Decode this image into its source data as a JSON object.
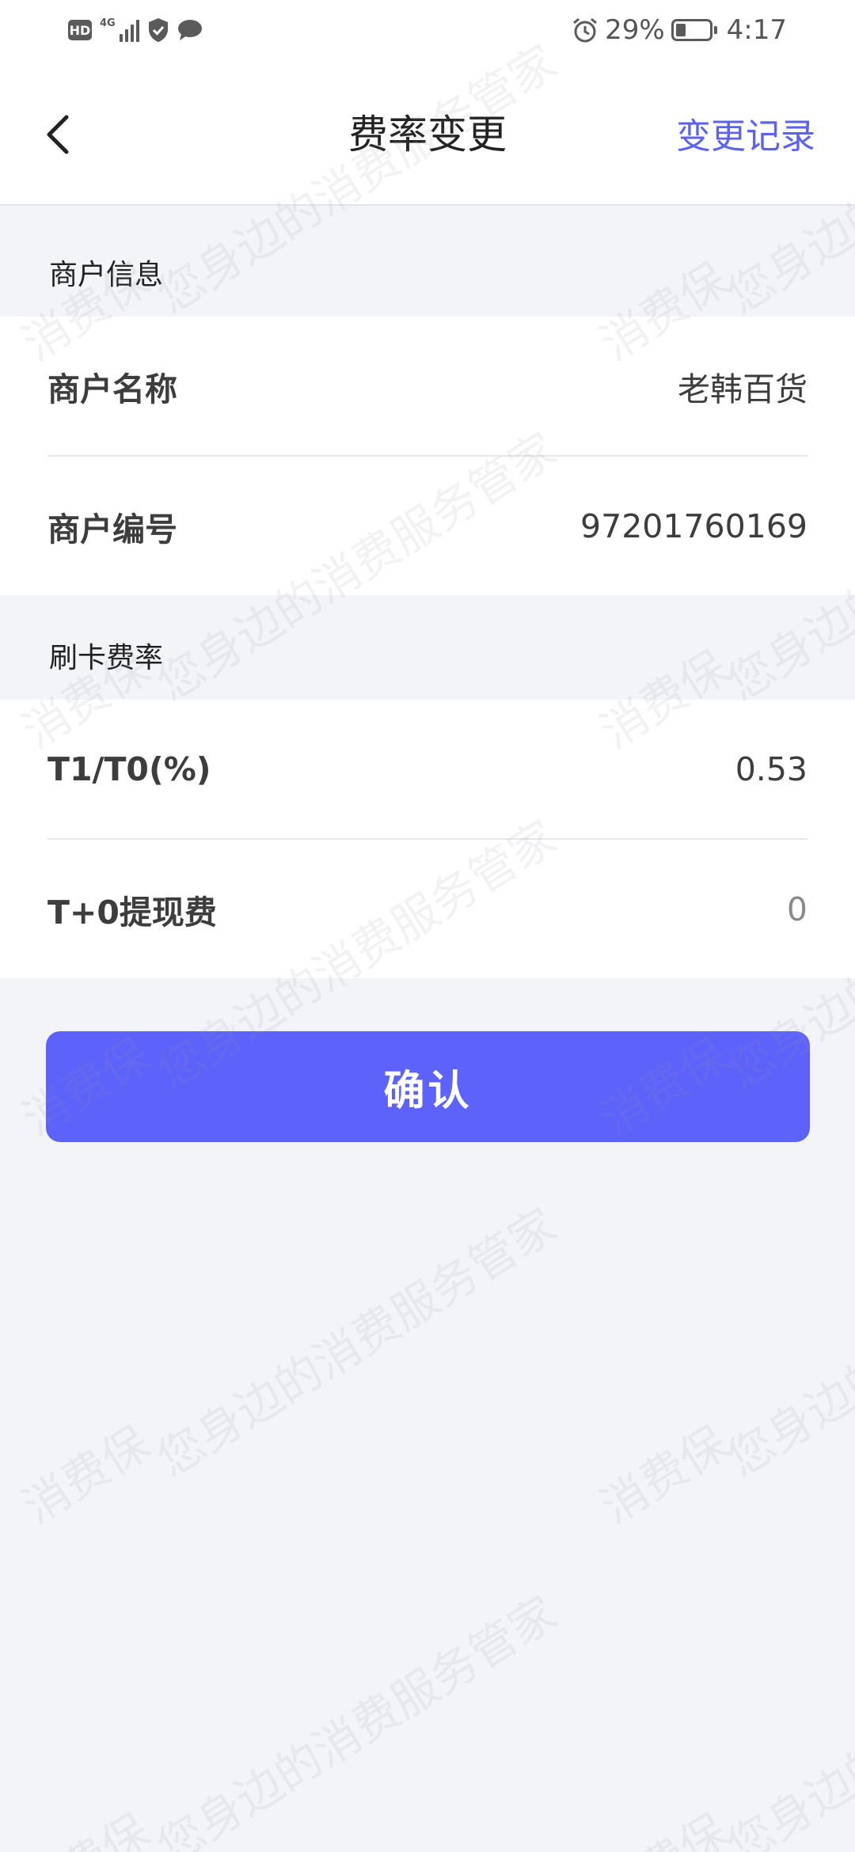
{
  "status_bar": {
    "hd_label": "HD",
    "network_label": "4G",
    "battery_percent_text": "29%",
    "battery_level": 0.29,
    "time": "4:17",
    "icons": [
      "hd-icon",
      "signal-icon",
      "shield-icon",
      "message-icon",
      "alarm-icon",
      "battery-icon"
    ]
  },
  "nav": {
    "title": "费率变更",
    "action_label": "变更记录",
    "back_icon": "chevron-left-icon",
    "accent_color": "#5b62f0"
  },
  "merchant_section": {
    "header": "商户信息",
    "rows": [
      {
        "label": "商户名称",
        "value": "老韩百货"
      },
      {
        "label": "商户编号",
        "value": "97201760169"
      }
    ]
  },
  "rate_section": {
    "header": "刷卡费率",
    "rows": [
      {
        "label": "T1/T0(%)",
        "value": "0.53"
      },
      {
        "label": "T+0提现费",
        "value": "0"
      }
    ]
  },
  "confirm_button": {
    "label": "确认",
    "color": "#5d62fb"
  },
  "watermark": {
    "short": "消费保",
    "long": "您身边的消费服务管家"
  }
}
